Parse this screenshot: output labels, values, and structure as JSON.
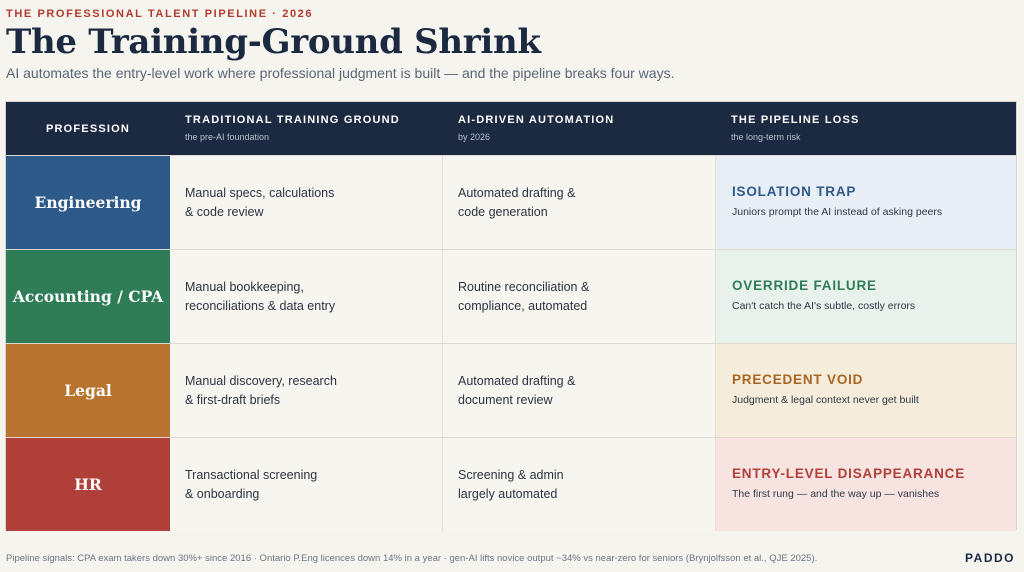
{
  "header": {
    "eyebrow": "THE PROFESSIONAL TALENT PIPELINE · 2026",
    "title": "The Training-Ground Shrink",
    "subtitle": "AI automates the entry-level work where professional judgment is built — and the pipeline breaks four ways."
  },
  "columns": {
    "profession": "PROFESSION",
    "traditional": {
      "label": "TRADITIONAL TRAINING GROUND",
      "sub": "the pre-AI foundation"
    },
    "automation": {
      "label": "AI-DRIVEN AUTOMATION",
      "sub": "by 2026"
    },
    "loss": {
      "label": "THE PIPELINE LOSS",
      "sub": "the long-term risk"
    }
  },
  "rows": [
    {
      "profession": "Engineering",
      "traditional": "Manual specs, calculations\n& code review",
      "automation": "Automated drafting &\ncode generation",
      "loss_title": "ISOLATION TRAP",
      "loss_desc": "Juniors prompt the AI instead of asking peers"
    },
    {
      "profession": "Accounting / CPA",
      "traditional": "Manual bookkeeping,\nreconciliations & data entry",
      "automation": "Routine reconciliation &\ncompliance, automated",
      "loss_title": "OVERRIDE FAILURE",
      "loss_desc": "Can't catch the AI's subtle, costly errors"
    },
    {
      "profession": "Legal",
      "traditional": "Manual discovery, research\n& first-draft briefs",
      "automation": "Automated drafting &\ndocument review",
      "loss_title": "PRECEDENT VOID",
      "loss_desc": "Judgment & legal context never get built"
    },
    {
      "profession": "HR",
      "traditional": "Transactional screening\n& onboarding",
      "automation": "Screening & admin\nlargely automated",
      "loss_title": "ENTRY-LEVEL DISAPPEARANCE",
      "loss_desc": "The first rung — and the way up — vanishes"
    }
  ],
  "colors": {
    "header_bg": "#1b2a41",
    "engineering": "#2e5a8a",
    "accounting": "#2e7d57",
    "legal": "#b8732e",
    "hr": "#b03f3a",
    "engineering_loss_bg": "#e8eef6",
    "accounting_loss_bg": "#e8f1eb",
    "legal_loss_bg": "#f6ecdc",
    "hr_loss_bg": "#f7e4e1",
    "engineering_loss_text": "#2e5a8a",
    "accounting_loss_text": "#2e7d57",
    "legal_loss_text": "#a8651f",
    "hr_loss_text": "#b03f3a"
  },
  "footer": {
    "signals": "Pipeline signals: CPA exam takers down 30%+ since 2016 · Ontario P.Eng licences down 14% in a year · gen-AI lifts novice output ~34% vs near-zero for seniors (Brynjolfsson et al., QJE 2025).",
    "brand": "PADDO"
  }
}
